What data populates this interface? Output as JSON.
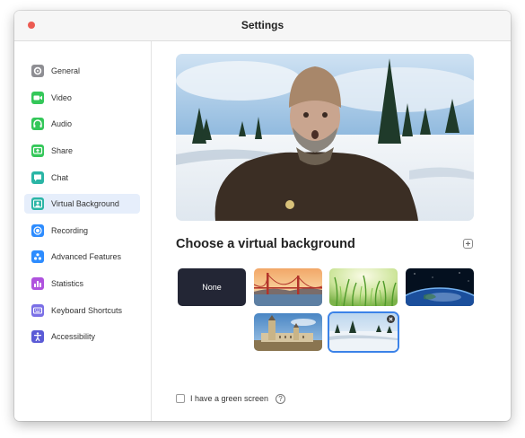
{
  "window": {
    "title": "Settings"
  },
  "sidebar": {
    "items": [
      {
        "label": "General",
        "icon": "gear-icon",
        "color": "#8e8e93",
        "selected": false
      },
      {
        "label": "Video",
        "icon": "video-icon",
        "color": "#34c759",
        "selected": false
      },
      {
        "label": "Audio",
        "icon": "headphones-icon",
        "color": "#34c759",
        "selected": false
      },
      {
        "label": "Share",
        "icon": "share-screen-icon",
        "color": "#34c759",
        "selected": false
      },
      {
        "label": "Chat",
        "icon": "chat-icon",
        "color": "#2ab5a5",
        "selected": false
      },
      {
        "label": "Virtual Background",
        "icon": "virtual-background-icon",
        "color": "#2ab5a5",
        "selected": true
      },
      {
        "label": "Recording",
        "icon": "record-icon",
        "color": "#2d8cff",
        "selected": false
      },
      {
        "label": "Advanced Features",
        "icon": "advanced-features-icon",
        "color": "#2d8cff",
        "selected": false
      },
      {
        "label": "Statistics",
        "icon": "statistics-icon",
        "color": "#af52de",
        "selected": false
      },
      {
        "label": "Keyboard Shortcuts",
        "icon": "keyboard-icon",
        "color": "#7a6fe6",
        "selected": false
      },
      {
        "label": "Accessibility",
        "icon": "accessibility-icon",
        "color": "#5b5bd6",
        "selected": false
      }
    ]
  },
  "main": {
    "heading": "Choose a virtual background",
    "backgrounds": [
      {
        "label": "None",
        "kind": "none",
        "selected": false
      },
      {
        "label": "",
        "kind": "golden-gate-bridge",
        "selected": false
      },
      {
        "label": "",
        "kind": "grass",
        "selected": false
      },
      {
        "label": "",
        "kind": "earth",
        "selected": false
      },
      {
        "label": "",
        "kind": "castle",
        "selected": false
      },
      {
        "label": "",
        "kind": "snowy-forest",
        "selected": true
      }
    ],
    "green_screen_label": "I have a green screen",
    "accent": "#3b82e8"
  }
}
